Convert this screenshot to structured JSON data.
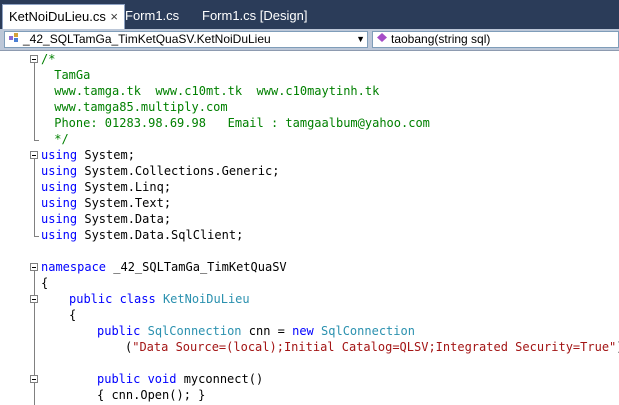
{
  "tabs": [
    {
      "label": "KetNoiDuLieu.cs",
      "close": "×"
    },
    {
      "label": "Form1.cs"
    },
    {
      "label": "Form1.cs [Design]"
    }
  ],
  "navbar": {
    "type_combo": "_42_SQLTamGa_TimKetQuaSV.KetNoiDuLieu",
    "member_combo": "taobang(string sql)"
  },
  "code": {
    "comment_open": "/*",
    "comment_author": " TamGa",
    "comment_sites": " www.tamga.tk  www.c10mt.tk  www.c10maytinh.tk",
    "comment_site2": " www.tamga85.multiply.com",
    "comment_contact": " Phone: 01283.98.69.98   Email : tamgaalbum@yahoo.com",
    "comment_close": " */",
    "using_kw": "using",
    "using1": " System;",
    "using2": " System.Collections.Generic;",
    "using3": " System.Linq;",
    "using4": " System.Text;",
    "using5": " System.Data;",
    "using6": " System.Data.SqlClient;",
    "ns_kw": "namespace",
    "ns_name": " _42_SQLTamGa_TimKetQuaSV",
    "brace_open": "{",
    "class_kw": "public class",
    "class_name": "KetNoiDuLieu",
    "brace_open2": "{",
    "field_kw": "public",
    "field_type": "SqlConnection",
    "field_mid": " cnn = ",
    "new_kw": "new",
    "field_type2": "SqlConnection",
    "conn_open": "(",
    "conn_string": "\"Data Source=(local);Initial Catalog=QLSV;Integrated Security=True\"",
    "conn_close": ");",
    "method_kw": "public void",
    "method_name": " myconnect()",
    "method_body": "{ cnn.Open(); }"
  },
  "colors": {
    "tabstrip_bg": "#2b3c59",
    "comment": "#008000",
    "keyword": "#0000ff",
    "type": "#2b91af",
    "string": "#a31515"
  }
}
